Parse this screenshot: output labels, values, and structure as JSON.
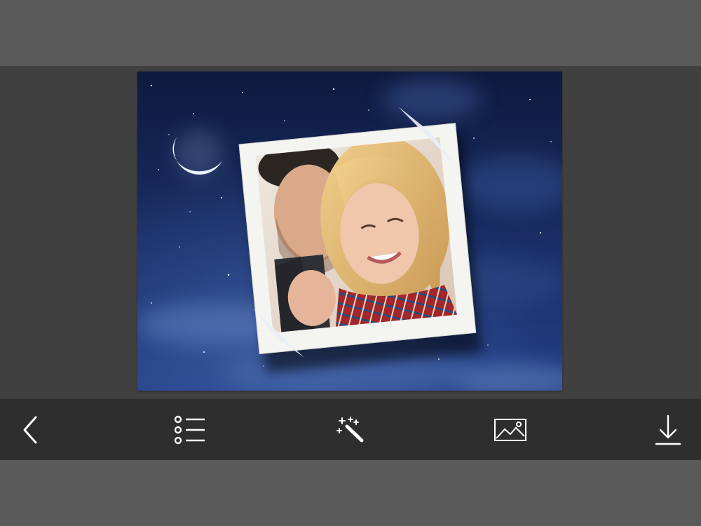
{
  "theme": {
    "outer_bg": "#5a5a5a",
    "workspace_bg": "#404040",
    "toolbar_bg": "#2e2e2e",
    "icon_color": "#ffffff",
    "sky_top": "#0e1a3f",
    "sky_bottom": "#233f86",
    "frame_color": "#f4f4f1"
  },
  "canvas": {
    "background": "night-sky-with-crescent-moon",
    "frame": "polaroid-photo-frame",
    "photo": "couple-photo"
  },
  "toolbar": {
    "back_icon": "chevron-left-icon",
    "list_icon": "list-icon",
    "magic_icon": "magic-wand-icon",
    "image_icon": "image-icon",
    "download_icon": "download-icon"
  }
}
